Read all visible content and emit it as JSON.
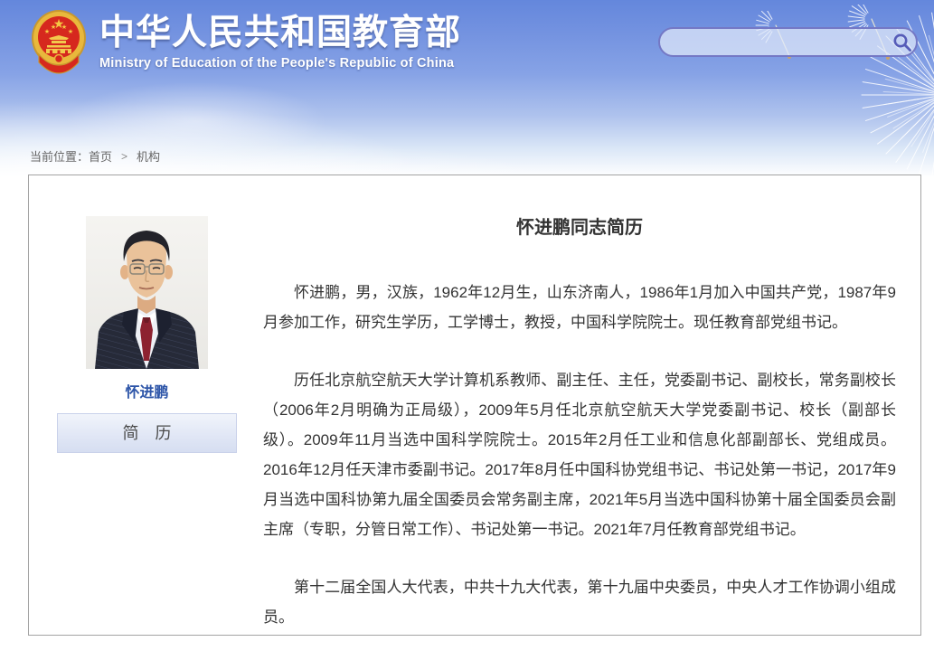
{
  "header": {
    "title_zh": "中华人民共和国教育部",
    "title_en": "Ministry of Education of the People's Republic of China",
    "search": {
      "value": "",
      "placeholder": ""
    }
  },
  "breadcrumb": {
    "prefix": "当前位置：",
    "home": "首页",
    "separator": ">",
    "current": "机构"
  },
  "profile": {
    "name": "怀进鹏",
    "resume_label": "简　历"
  },
  "article": {
    "title": "怀进鹏同志简历",
    "paragraphs": [
      "怀进鹏，男，汉族，1962年12月生，山东济南人，1986年1月加入中国共产党，1987年9月参加工作，研究生学历，工学博士，教授，中国科学院院士。现任教育部党组书记。",
      "历任北京航空航天大学计算机系教师、副主任、主任，党委副书记、副校长，常务副校长（2006年2月明确为正局级），2009年5月任北京航空航天大学党委副书记、校长（副部长级）。2009年11月当选中国科学院院士。2015年2月任工业和信息化部副部长、党组成员。2016年12月任天津市委副书记。2017年8月任中国科协党组书记、书记处第一书记，2017年9月当选中国科协第九届全国委员会常务副主席，2021年5月当选中国科协第十届全国委员会副主席（专职，分管日常工作）、书记处第一书记。2021年7月任教育部党组书记。",
      "第十二届全国人大代表，中共十九大代表，第十九届中央委员，中央人才工作协调小组成员。"
    ]
  },
  "icons": {
    "search": "magnifier-icon",
    "logo": "national-emblem-icon",
    "decoration": "dandelion"
  },
  "colors": {
    "sky_top": "#6487dc",
    "link_blue": "#2d55a8",
    "emblem_red": "#d6281e",
    "emblem_gold": "#e9b83c",
    "search_border": "#7478c5",
    "panel_border": "#a3a3a3",
    "body_text": "#333333"
  }
}
